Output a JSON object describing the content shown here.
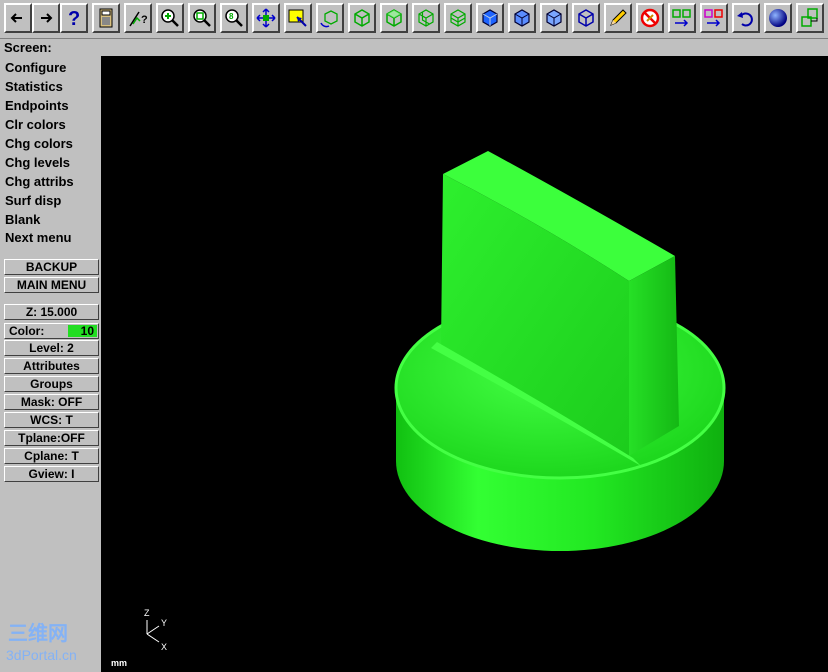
{
  "prompt": {
    "label": "Screen:"
  },
  "toolbar": {
    "icons": [
      "arrow-left-icon",
      "arrow-right-icon",
      "help-icon",
      "calculator-icon",
      "analyze-icon",
      "zoom-in-icon",
      "zoom-out-icon",
      "zoom-8-icon",
      "pan-icon",
      "select-window-icon",
      "rotate-view-icon",
      "wireframe-cube-icon",
      "cube-green-icon",
      "cube-green-shaded-icon",
      "cube-green-mesh-icon",
      "cube-green-grid-icon",
      "cube-blue-icon",
      "cube-blue-2-icon",
      "cube-blue-3-icon",
      "cube-outline-icon",
      "pencil-icon",
      "no-paint-icon",
      "move-geometry-icon",
      "copy-geometry-icon",
      "undo-icon",
      "sphere-render-icon",
      "layers-icon"
    ]
  },
  "menu": {
    "items": [
      "Configure",
      "Statistics",
      "Endpoints",
      "Clr colors",
      "Chg colors",
      "Chg levels",
      "Chg attribs",
      "Surf disp",
      "Blank",
      "Next menu"
    ]
  },
  "nav": {
    "backup": "BACKUP",
    "main_menu": "MAIN MENU"
  },
  "status": {
    "z": "Z:  15.000",
    "color_label": "Color:",
    "color_value": "10",
    "level": "Level:  2",
    "attributes": "Attributes",
    "groups": "Groups",
    "mask": "Mask:  OFF",
    "wcs": "WCS:   T",
    "tplane": "Tplane:OFF",
    "cplane": "Cplane:  T",
    "gview": "Gview:   I"
  },
  "viewport": {
    "units": "mm",
    "axes": {
      "z": "Z",
      "y": "Y",
      "x": "X"
    },
    "watermark": "三维网 3dPortal.cn"
  },
  "colors": {
    "model_green": "#22ee22",
    "background": "#000000",
    "ui_gray": "#c0c0c0"
  }
}
